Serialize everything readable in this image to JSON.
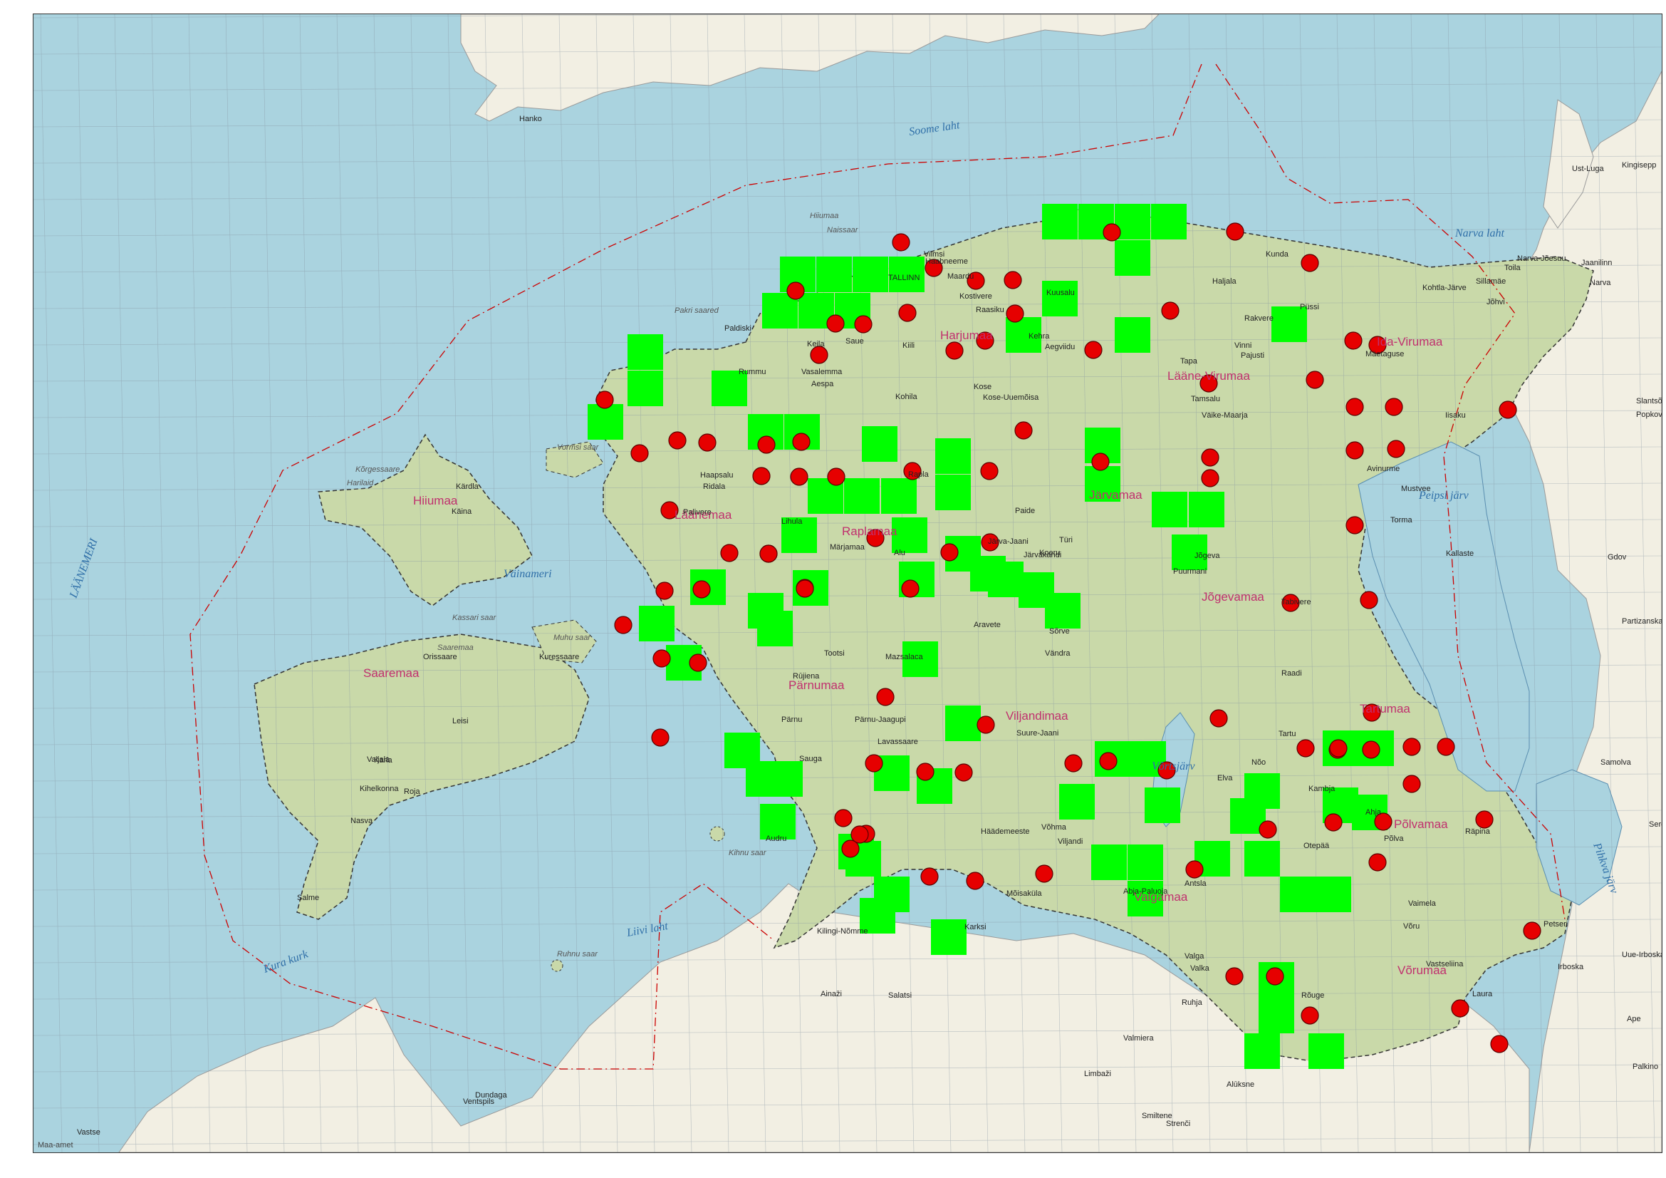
{
  "map": {
    "credit": "Maa-amet",
    "colors": {
      "sea": "#aad3df",
      "estonia_land": "#c9d9a9",
      "neighbor_land": "#f2efe3",
      "grid_square": "#00ff00",
      "observation_dot": "#e60000",
      "border": "#cc0000",
      "grid_line": "#9aa5b0"
    },
    "sea_labels": [
      "Soome laht",
      "Narva laht",
      "LÄÄNEMERI",
      "Väinameri",
      "Liivi laht",
      "Kura kurk",
      "Peipsi järv",
      "Pihkva järv",
      "Võrtsjärv"
    ],
    "county_labels": [
      "Harjumaa",
      "Lääne-Virumaa",
      "Ida-Virumaa",
      "Hiiumaa",
      "Läänemaa",
      "Raplamaa",
      "Järvamaa",
      "Jõgevamaa",
      "Saaremaa",
      "Pärnumaa",
      "Viljandimaa",
      "Tartumaa",
      "Valgamaa",
      "Põlvamaa",
      "Võrumaa"
    ],
    "island_labels": [
      "Hiiumaa",
      "Naissaar",
      "Pakri saared",
      "Vormsi saar",
      "Kõrgessaare",
      "Kassari saar",
      "Muhu saar",
      "Saaremaa",
      "Kihnu saar",
      "Ruhnu saar",
      "Harilaid"
    ],
    "town_labels": [
      "Hanko",
      "TALLINN",
      "Viimsi",
      "Maardu",
      "Kostivere",
      "Raasiku",
      "Kehra",
      "Kuusalu",
      "Aegviidu",
      "Haabneeme",
      "Paldiski",
      "Keila",
      "Saue",
      "Kiili",
      "Kohila",
      "Rummu",
      "Vasalemma",
      "Aespa",
      "Kose",
      "Kose-Uuemõisa",
      "Kunda",
      "Haljala",
      "Rakvere",
      "Tapa",
      "Vinni",
      "Pajusti",
      "Tamsalu",
      "Väike-Maarja",
      "Püssi",
      "Kohtla-Järve",
      "Jõhvi",
      "Sillamäe",
      "Narva-Jõesuu",
      "Narva",
      "Toila",
      "Jaanilinn",
      "Ust-Luga",
      "Kingisepp",
      "Slantsõ",
      "Popkova",
      "Iisaku",
      "Mäetaguse",
      "Avinurme",
      "Mustvee",
      "Torma",
      "Kallaste",
      "Jõgeva",
      "Puurmani",
      "Tabivere",
      "Raadi",
      "Tartu",
      "Elva",
      "Nõo",
      "Kambja",
      "Ahja",
      "Põlva",
      "Räpina",
      "Otepää",
      "Võru",
      "Vaimela",
      "Antsla",
      "Valga",
      "Valka",
      "Rõuge",
      "Vastseliina",
      "Laura",
      "Petseri",
      "Irboska",
      "Uue-Irboska",
      "Palkino",
      "Samolva",
      "Partizanskaja",
      "Gdov",
      "Sered",
      "Kärdla",
      "Käina",
      "Haapsalu",
      "Ridala",
      "Palivere",
      "Lihula",
      "Märjamaa",
      "Rapla",
      "Alu",
      "Järvakandi",
      "Türi",
      "Paide",
      "Koeru",
      "Järva-Jaani",
      "Aravete",
      "Sõrve",
      "Vändra",
      "Suure-Jaani",
      "Võhma",
      "Viljandi",
      "Abja-Paluoja",
      "Mõisaküla",
      "Karksi",
      "Ruhja",
      "Mazsalaca",
      "Rūjiena",
      "Tootsi",
      "Lavassaare",
      "Pärnu-Jaagupi",
      "Pärnu",
      "Sauga",
      "Audru",
      "Häädemeeste",
      "Kilingi-Nõmme",
      "Ainaži",
      "Salatsi",
      "Limbaži",
      "Valmiera",
      "Strenči",
      "Smiltene",
      "Alūksne",
      "Ape",
      "Vastse",
      "Ventspils",
      "Dundaga",
      "Roja",
      "Kuressaare",
      "Orissaare",
      "Leisi",
      "Valjala",
      "Karla",
      "Kihelkonna",
      "Nasva",
      "Salme",
      "Sõrve"
    ],
    "grid_squares_count": 86,
    "observation_dots_count": 104
  }
}
